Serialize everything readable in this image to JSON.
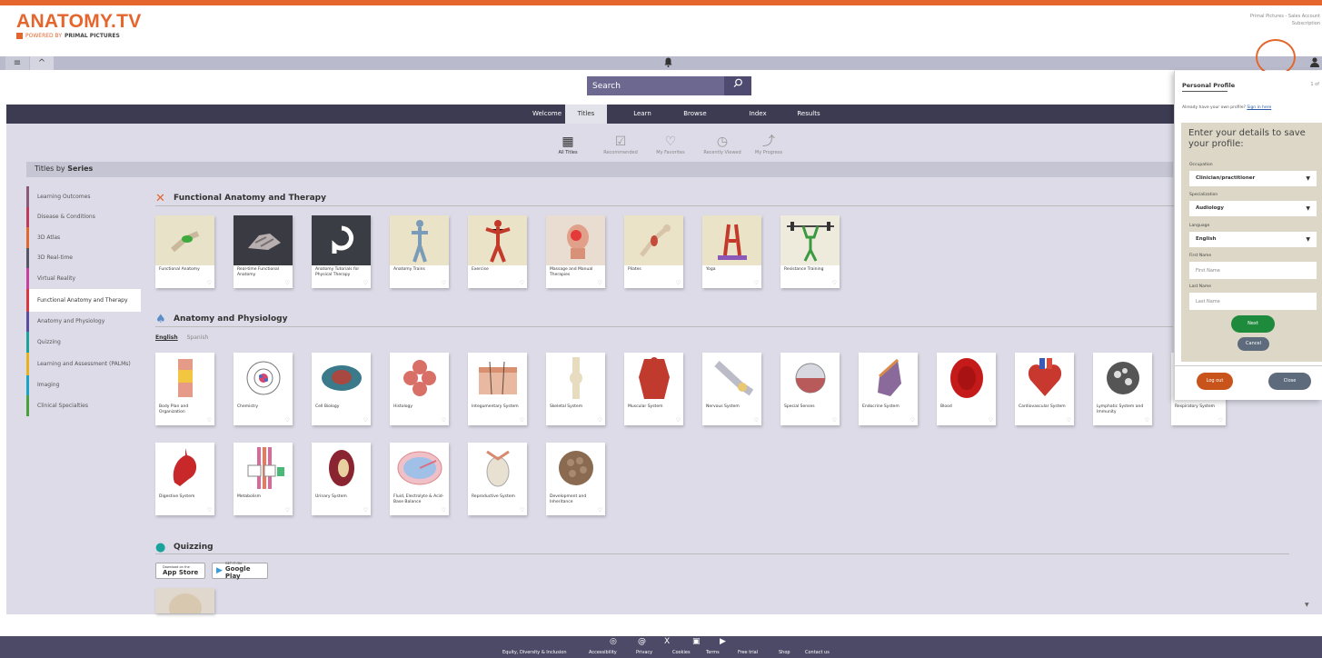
{
  "brand": {
    "title": "ANATOMY.TV",
    "powered": "POWERED BY",
    "company": "PRIMAL PICTURES",
    "accent": "#e4662d"
  },
  "account": {
    "line1": "Primal Pictures - Sales Account",
    "line2": "Subscription"
  },
  "search": {
    "placeholder": "Search"
  },
  "nav": {
    "tabs": [
      "Welcome",
      "Titles",
      "Learn",
      "Browse",
      "Index",
      "Results"
    ],
    "active": "Titles"
  },
  "subnav": [
    {
      "label": "All Titles",
      "icon": "grid-icon"
    },
    {
      "label": "Recommended",
      "icon": "check-icon"
    },
    {
      "label": "My Favorites",
      "icon": "heart-icon"
    },
    {
      "label": "Recently Viewed",
      "icon": "clock-icon"
    },
    {
      "label": "My Progress",
      "icon": "progress-icon"
    }
  ],
  "series_title": {
    "prefix": "Titles by ",
    "bold": "Series"
  },
  "sidebar": [
    {
      "label": "Learning Outcomes",
      "color": "#8b5a7a"
    },
    {
      "label": "Disease & Conditions",
      "color": "#c0395a"
    },
    {
      "label": "3D Atlas",
      "color": "#e4662d"
    },
    {
      "label": "3D Real-time",
      "color": "#555566"
    },
    {
      "label": "Virtual Reality",
      "color": "#c83fa0"
    },
    {
      "label": "Functional Anatomy and Therapy",
      "color": "#d9363e",
      "active": true
    },
    {
      "label": "Anatomy and Physiology",
      "color": "#5a4da0"
    },
    {
      "label": "Quizzing",
      "color": "#1aa39a"
    },
    {
      "label": "Learning and Assessment (PALMs)",
      "color": "#e8b21f"
    },
    {
      "label": "Imaging",
      "color": "#17a4c5"
    },
    {
      "label": "Clinical Specialties",
      "color": "#4aa03b"
    }
  ],
  "sections": {
    "functional": "Functional Anatomy and Therapy",
    "anatomy": "Anatomy and Physiology",
    "quizzing": "Quizzing"
  },
  "lang_tabs": {
    "english": "English",
    "spanish": "Spanish"
  },
  "functional_cards": [
    "Functional Anatomy",
    "Real-time Functional Anatomy",
    "Anatomy Tutorials for Physical Therapy",
    "Anatomy Trains",
    "Exercise",
    "Massage and Manual Therapies",
    "Pilates",
    "Yoga",
    "Resistance Training"
  ],
  "anatomy_cards_row1": [
    "Body Plan and Organization",
    "Chemistry",
    "Cell Biology",
    "Histology",
    "Integumentary System",
    "Skeletal System",
    "Muscular System",
    "Nervous System",
    "Special Senses",
    "Endocrine System",
    "Blood",
    "Cardiovascular System",
    "Lymphatic System and Immunity",
    "Respiratory System"
  ],
  "anatomy_cards_row2": [
    "Digestive System",
    "Metabolism",
    "Urinary System",
    "Fluid, Electrolyte & Acid-Base Balance",
    "Reproductive System",
    "Development and Inheritance"
  ],
  "stores": {
    "apple_small": "Download on the",
    "apple": "App Store",
    "google_small": "GET IT ON",
    "google": "Google Play"
  },
  "footer": {
    "links": [
      "Equity, Diversity & Inclusion",
      "Accessibility",
      "Privacy",
      "Cookies",
      "Terms",
      "Free trial",
      "Shop",
      "Contact us"
    ]
  },
  "profile": {
    "title": "Personal Profile",
    "page": "1 of",
    "already": "Already have your own profile?",
    "signin": "Sign in here",
    "heading": "Enter your details to save your profile:",
    "occupation_label": "Occupation",
    "occupation": "Clinician/practitioner",
    "specialization_label": "Specialization",
    "specialization": "Audiology",
    "language_label": "Language",
    "language": "English",
    "first_label": "First Name",
    "first_placeholder": "First Name",
    "last_label": "Last Name",
    "last_placeholder": "Last Name",
    "next": "Next",
    "cancel": "Cancel",
    "logout": "Log out",
    "close": "Close"
  }
}
